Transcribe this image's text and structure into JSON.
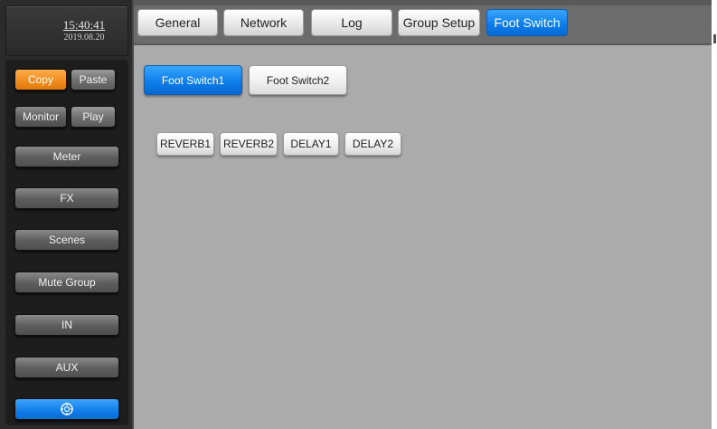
{
  "clock": {
    "time": "15:40:41",
    "date": "2019.08.20"
  },
  "sidebar": {
    "copy": "Copy",
    "paste": "Paste",
    "monitor": "Monitor",
    "play": "Play",
    "meter": "Meter",
    "fx": "FX",
    "scenes": "Scenes",
    "mute_group": "Mute Group",
    "in": "IN",
    "aux": "AUX",
    "bottom_icon": "crosshair-icon"
  },
  "tabs": {
    "general": "General",
    "network": "Network",
    "log": "Log",
    "group_setup": "Group Setup",
    "foot_switch": "Foot Switch",
    "active": "Foot Switch"
  },
  "foot_switch": {
    "fs1": "Foot Switch1",
    "fs2": "Foot Switch2",
    "active": "Foot Switch1",
    "effects": [
      "REVERB1",
      "REVERB2",
      "DELAY1",
      "DELAY2"
    ]
  },
  "colors": {
    "accent_blue": "#0b7ce9",
    "accent_orange": "#f08a1b",
    "main_bg": "#ababab",
    "sidebar_bg": "#1d1d1d"
  }
}
